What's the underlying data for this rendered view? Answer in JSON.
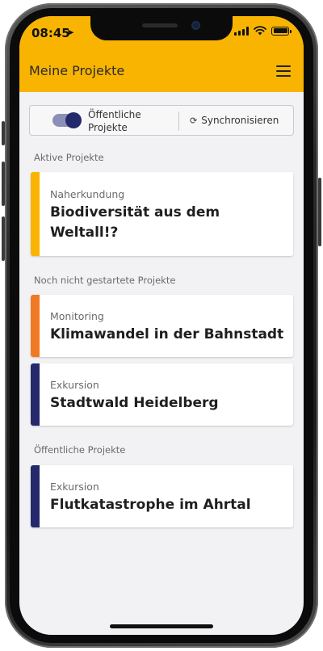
{
  "status": {
    "time": "08:45"
  },
  "appbar": {
    "title": "Meine Projekte"
  },
  "toolbar": {
    "toggle_label": "Öffentliche Projekte",
    "sync_label": "Synchronisieren"
  },
  "sections": {
    "active": "Aktive Projekte",
    "not_started": "Noch nicht gestartete Projekte",
    "public": "Öffentliche Projekte"
  },
  "projects": [
    {
      "category": "Naherkundung",
      "title": "Biodiversität aus dem Weltall!?",
      "color": "#f8b400"
    },
    {
      "category": "Monitoring",
      "title": "Klimawandel in der Bahnstadt",
      "color": "#f07a23"
    },
    {
      "category": "Exkursion",
      "title": "Stadtwald Heidelberg",
      "color": "#25296b"
    },
    {
      "category": "Exkursion",
      "title": "Flutkatastrophe im Ahrtal",
      "color": "#25296b"
    }
  ],
  "colors": {
    "accent": "#f8b400",
    "toggle_active": "#23296b"
  },
  "icons": [
    "location-arrow-icon",
    "signal-icon",
    "wifi-icon",
    "battery-icon",
    "menu-icon",
    "sync-icon"
  ]
}
